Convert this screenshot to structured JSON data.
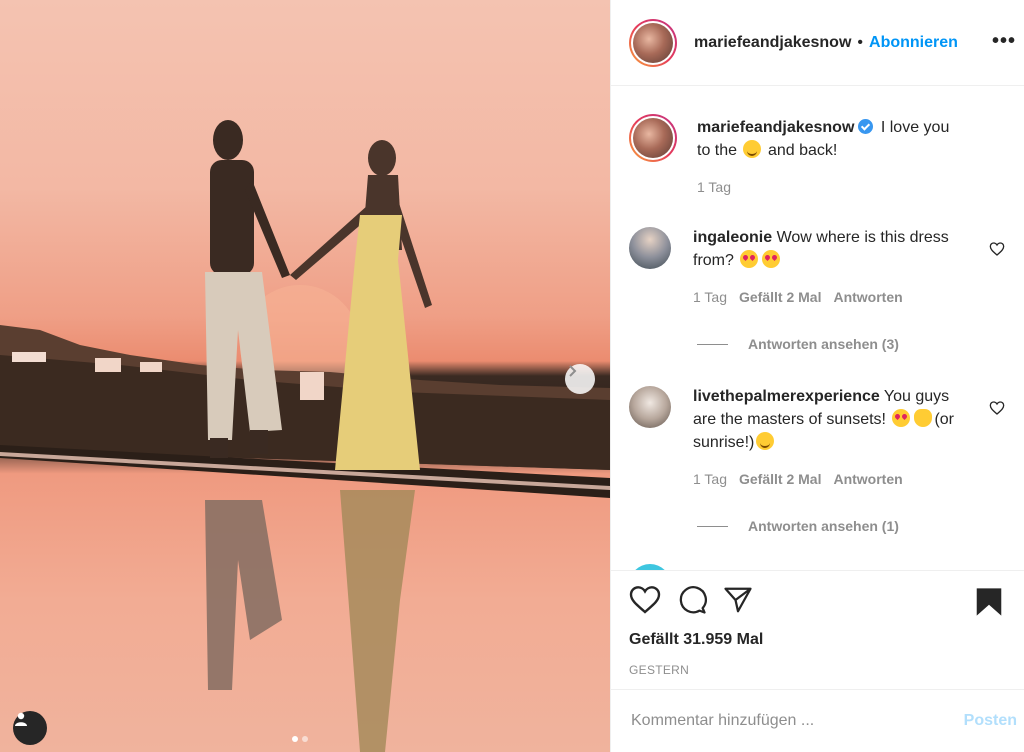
{
  "post": {
    "username": "mariefeandjakesnow",
    "separator": "•",
    "follow_label": "Abonnieren",
    "more_label": "•••"
  },
  "caption": {
    "username": "mariefeandjakesnow",
    "text_part1": "I love you to the",
    "text_part2": "and back!",
    "time": "1 Tag"
  },
  "comments": [
    {
      "username": "ingaleonie",
      "text": "Wow where is this dress from?",
      "time": "1 Tag",
      "likes": "Gefällt 2 Mal",
      "reply": "Antworten",
      "view_replies": "Antworten ansehen (3)"
    },
    {
      "username": "livethepalmerexperience",
      "text": "You guys are the masters of sunsets!",
      "text_tail": "(or sunrise!)",
      "time": "1 Tag",
      "likes": "Gefällt 2 Mal",
      "reply": "Antworten",
      "view_replies": "Antworten ansehen (1)"
    }
  ],
  "footer": {
    "like_count": "Gefällt 31.959 Mal",
    "date": "GESTERN",
    "comment_placeholder": "Kommentar hinzufügen ...",
    "post_label": "Posten"
  },
  "colors": {
    "accent": "#0095f6",
    "muted": "#8e8e8e",
    "post_disabled": "#b2dffc"
  },
  "carousel": {
    "slides": 2,
    "active_slide": 1
  }
}
